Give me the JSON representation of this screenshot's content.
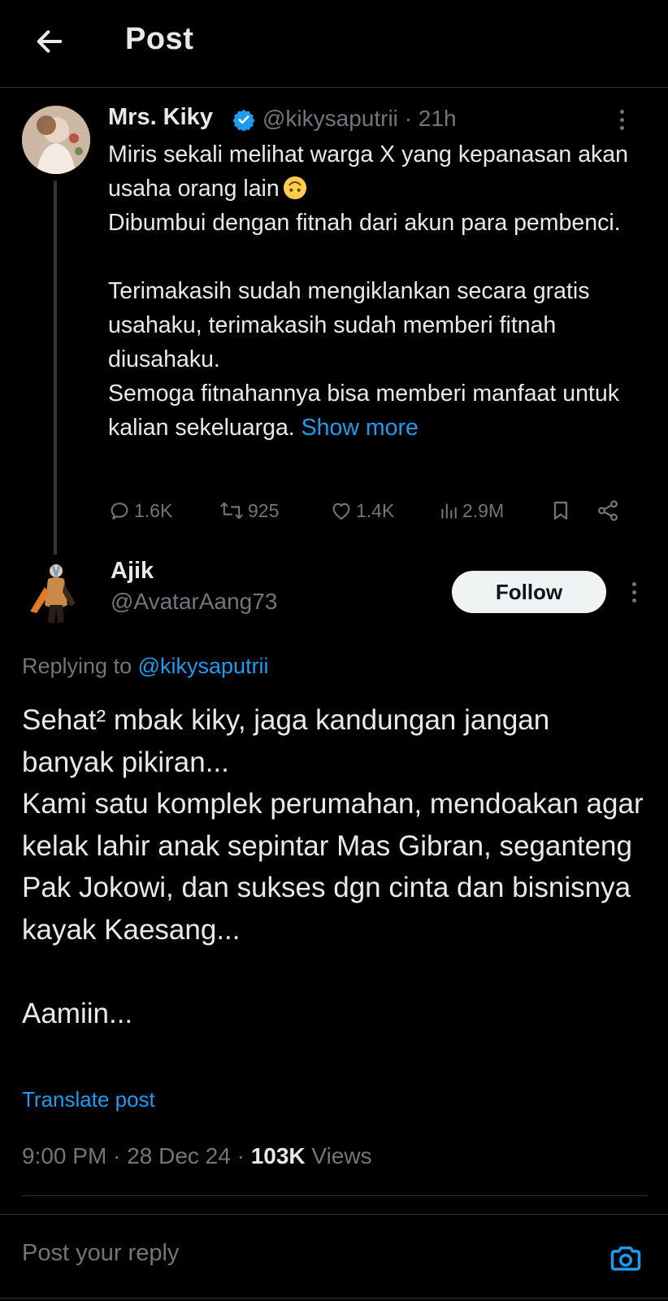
{
  "header": {
    "title": "Post",
    "back_icon": "arrow-left-icon"
  },
  "parent_post": {
    "display_name": "Mrs. Kiky",
    "verified": true,
    "handle": "@kikysaputrii",
    "separator": "·",
    "time_ago": "21h",
    "text_lines": [
      "Miris sekali melihat warga X yang kepanasan akan usaha orang lain",
      "Dibumbui dengan fitnah dari akun para pembenci.",
      "Terimakasih sudah mengiklankan secara gratis usahaku, terimakasih sudah memberi fitnah diusahaku.",
      "Semoga fitnahannya bisa memberi manfaat untuk kalian sekeluarga."
    ],
    "emoji": "upside-down-face-emoji",
    "show_more_label": "Show more",
    "stats": {
      "replies": "1.6K",
      "reposts": "925",
      "likes": "1.4K",
      "views": "2.9M"
    }
  },
  "reply_post": {
    "display_name": "Ajik",
    "handle": "@AvatarAang73",
    "follow_label": "Follow",
    "replying_to_label": "Replying to",
    "replying_to_handle": "@kikysaputrii",
    "text_lines": [
      "Sehat² mbak kiky, jaga kandungan jangan banyak pikiran...",
      "Kami satu komplek perumahan, mendoakan agar kelak lahir anak sepintar Mas Gibran, seganteng Pak Jokowi, dan sukses dgn cinta dan bisnisnya kayak Kaesang...",
      "Aamiin..."
    ],
    "translate_label": "Translate post",
    "time": "9:00 PM",
    "date": "28 Dec 24",
    "views_count": "103K",
    "views_label": "Views",
    "separator": "·"
  },
  "composer": {
    "placeholder": "Post your reply",
    "camera_icon": "camera-icon"
  },
  "colors": {
    "background": "#000000",
    "text_primary": "#e7e9ea",
    "text_secondary": "#71767b",
    "accent": "#1d9bf0",
    "divider": "#2f3336",
    "follow_button_bg": "#eff3f4"
  }
}
